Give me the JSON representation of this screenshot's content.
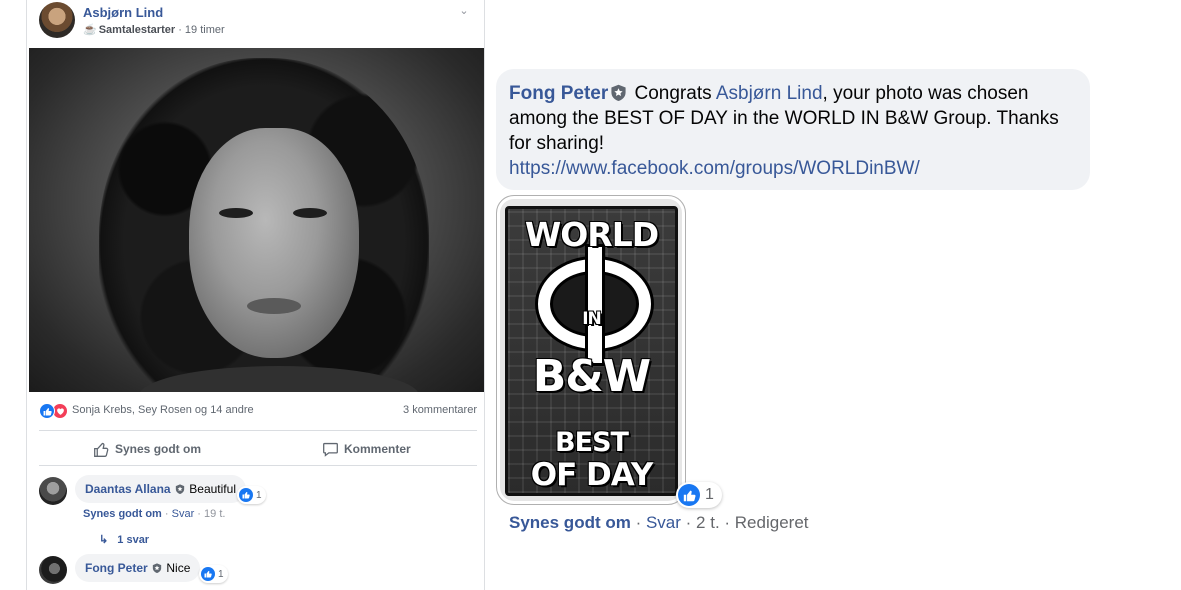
{
  "post": {
    "author": "Asbjørn Lind",
    "badge": "Samtalestarter",
    "time": "19 timer",
    "menu_icon": "chevron-down-icon",
    "reactions_text": "Sonja Krebs, Sey Rosen og 14 andre",
    "comments_count": "3 kommentarer",
    "like_label": "Synes godt om",
    "comment_label": "Kommenter"
  },
  "comments": [
    {
      "name": "Daantas Allana",
      "text": "Beautiful",
      "reactions": "1",
      "like_action": "Synes godt om",
      "reply_action": "Svar",
      "time": "19 t.",
      "replies": "1 svar"
    },
    {
      "name": "Fong Peter",
      "text": "Nice",
      "reactions": "1"
    }
  ],
  "featured_comment": {
    "name": "Fong Peter",
    "text_before": " Congrats ",
    "mention": "Asbjørn Lind",
    "text_after": ", your photo was chosen among the BEST OF DAY in the WORLD IN B&W Group. Thanks for sharing!",
    "link": "https://www.facebook.com/groups/WORLDinBW/",
    "reactions": "1",
    "like_action": "Synes godt om",
    "reply_action": "Svar",
    "time": "2 t.",
    "edited": "Redigeret",
    "logo": {
      "line1": "WORLD",
      "line2": "IN",
      "line3": "B&W",
      "line4": "BEST",
      "line5": "OF DAY"
    }
  },
  "colors": {
    "link_blue": "#385898",
    "like_blue": "#1877f2",
    "love_red": "#f33e58",
    "bubble_grey": "#f0f2f5"
  }
}
